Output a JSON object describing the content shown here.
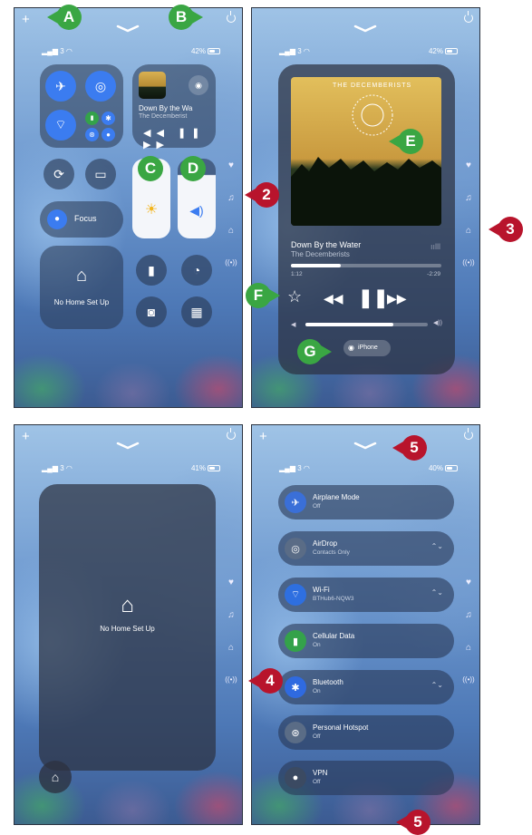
{
  "callouts": {
    "a": "A",
    "b": "B",
    "c": "C",
    "d": "D",
    "e": "E",
    "f": "F",
    "g": "G",
    "n2": "2",
    "n3": "3",
    "n4": "4",
    "n5a": "5",
    "n5b": "5"
  },
  "status": {
    "signal_1": "3",
    "battery_1": "42%",
    "battery_2": "42%",
    "battery_3": "41%",
    "battery_4": "40%"
  },
  "panel1": {
    "now_playing_title": "Down By the Wa",
    "now_playing_artist": "The Decemberist",
    "focus_label": "Focus",
    "home_label": "No Home Set Up"
  },
  "panel2": {
    "album_art_text": "THE DECEMBERISTS",
    "track_title": "Down By the Water",
    "track_artist": "The Decemberists",
    "time_elapsed": "1:12",
    "time_remaining": "-2:29",
    "output_label": "iPhone"
  },
  "panel3": {
    "home_label": "No Home Set Up"
  },
  "panel4": {
    "rows": [
      {
        "title": "Airplane Mode",
        "sub": "Off",
        "color": "#3a6fd8"
      },
      {
        "title": "AirDrop",
        "sub": "Contacts Only",
        "color": "#5a6c86"
      },
      {
        "title": "Wi-Fi",
        "sub": "BTHub6-NQW3",
        "color": "#2e6fe0"
      },
      {
        "title": "Cellular Data",
        "sub": "On",
        "color": "#34a24a"
      },
      {
        "title": "Bluetooth",
        "sub": "On",
        "color": "#2f6ae0"
      },
      {
        "title": "Personal Hotspot",
        "sub": "Off",
        "color": "#5a6c86"
      },
      {
        "title": "VPN",
        "sub": "Off",
        "color": "#3b4a62"
      }
    ]
  },
  "accent": {
    "green": "#3aa643",
    "red": "#b8142c"
  }
}
